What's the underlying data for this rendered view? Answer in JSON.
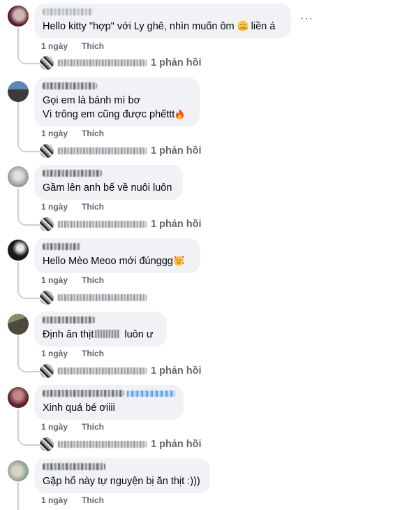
{
  "labels": {
    "time": "1 ngày",
    "like": "Thích",
    "more": "···"
  },
  "comments": [
    {
      "text": "Hello kitty \"hợp\" với Ly ghê, nhìn muốn ôm",
      "text_after": " liền á",
      "emoji": "hugging-face",
      "reply_count": "1 phản hồi",
      "avatar_colors": [
        "#5b1a2a",
        "#c9b7b3"
      ]
    },
    {
      "text": "Gọi em là bánh mì bơ\nVì trông em cũng được phếttt",
      "emoji": "fire",
      "reply_count": "1 phản hồi",
      "avatar_colors": [
        "#5f86b7",
        "#3b3b3b"
      ]
    },
    {
      "text": "Gầm lên anh bế về nuôi luôn",
      "reply_count": "1 phản hồi",
      "avatar_colors": [
        "#9a9895",
        "#e0dfdc"
      ]
    },
    {
      "text": "Hello Mèo Meoo mới đúnggg",
      "emoji": "smiling-face-with-hearts",
      "reply_count": "",
      "avatar_colors": [
        "#1a1a1a",
        "#e6e6e6"
      ]
    },
    {
      "text": "Định ăn thịt",
      "text_after": " luôn ư",
      "reply_count": "1 phản hồi",
      "avatar_colors": [
        "#4d4a3c",
        "#8a8a6c"
      ]
    },
    {
      "text": "Xinh quá bé ơiiii",
      "reply_count": "1 phản hồi",
      "avatar_colors": [
        "#5c1f2a",
        "#c48787"
      ]
    },
    {
      "text": "Gặp hổ này tự nguyện bị ăn thịt :)))",
      "reply_count": "",
      "avatar_colors": [
        "#8aa38a",
        "#d9d3c8"
      ]
    }
  ]
}
